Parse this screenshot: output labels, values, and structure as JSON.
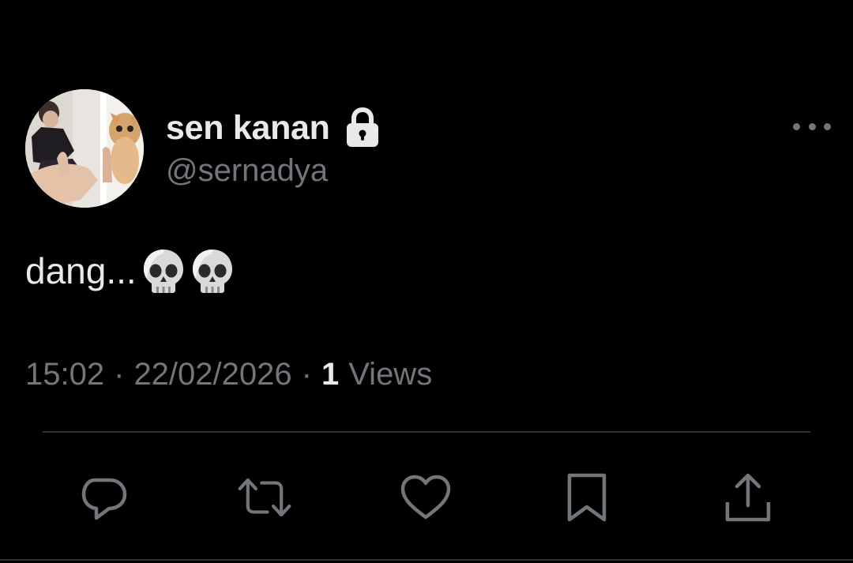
{
  "tweet": {
    "author": {
      "display_name": "sen kanan",
      "handle": "@sernadya",
      "protected_icon": "lock-icon",
      "avatar": "avatar-photo"
    },
    "text": "dang...",
    "emojis": [
      "skull",
      "skull"
    ],
    "timestamp": {
      "time": "15:02",
      "separator": "·",
      "date": "22/02/2026",
      "views_count": "1",
      "views_label": "Views"
    },
    "more_icon": "more-horizontal-icon",
    "actions": [
      {
        "name": "reply",
        "icon": "reply-icon"
      },
      {
        "name": "retweet",
        "icon": "retweet-icon"
      },
      {
        "name": "like",
        "icon": "heart-icon"
      },
      {
        "name": "bookmark",
        "icon": "bookmark-icon"
      },
      {
        "name": "share",
        "icon": "share-icon"
      }
    ]
  },
  "colors": {
    "background": "#000000",
    "primary_text": "#e7e9ea",
    "secondary_text": "#71767b",
    "divider": "#2f3336"
  }
}
